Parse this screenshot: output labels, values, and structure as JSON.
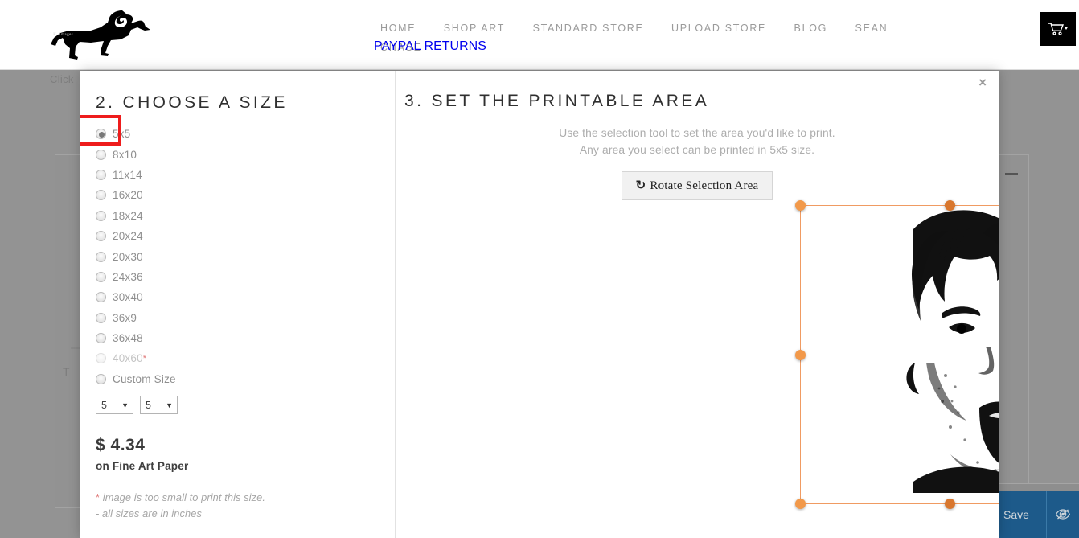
{
  "header": {
    "logo_caption": "J.K. Images",
    "nav": [
      {
        "label": "HOME"
      },
      {
        "label": "SHOP ART"
      },
      {
        "label": "STANDARD STORE"
      },
      {
        "label": "UPLOAD STORE"
      },
      {
        "label": "BLOG"
      },
      {
        "label": "SEAN"
      },
      {
        "label": "CHASE"
      }
    ],
    "nav_row2": [
      {
        "label": "PAYPAL RETURNS"
      }
    ],
    "cart_icon": "shopping-cart-icon"
  },
  "background": {
    "click_text": "Click",
    "t_text": "T",
    "save_label": "Save",
    "preview_icon": "eye-slash-icon"
  },
  "modal": {
    "close_label": "×",
    "size_step": {
      "title": "2. CHOOSE A SIZE",
      "options": [
        {
          "label": "5x5",
          "checked": true,
          "faded": false,
          "star": false
        },
        {
          "label": "8x10",
          "checked": false,
          "faded": false,
          "star": false
        },
        {
          "label": "11x14",
          "checked": false,
          "faded": false,
          "star": false
        },
        {
          "label": "16x20",
          "checked": false,
          "faded": false,
          "star": false
        },
        {
          "label": "18x24",
          "checked": false,
          "faded": false,
          "star": false
        },
        {
          "label": "20x24",
          "checked": false,
          "faded": false,
          "star": false
        },
        {
          "label": "20x30",
          "checked": false,
          "faded": false,
          "star": false
        },
        {
          "label": "24x36",
          "checked": false,
          "faded": false,
          "star": false
        },
        {
          "label": "30x40",
          "checked": false,
          "faded": false,
          "star": false
        },
        {
          "label": "36x9",
          "checked": false,
          "faded": false,
          "star": false
        },
        {
          "label": "36x48",
          "checked": false,
          "faded": false,
          "star": false
        },
        {
          "label": "40x60",
          "checked": false,
          "faded": true,
          "star": true
        },
        {
          "label": "Custom Size",
          "checked": false,
          "faded": false,
          "star": false
        }
      ],
      "custom_width": "5",
      "custom_height": "5",
      "price_currency": "$",
      "price_amount": "4.34",
      "paper_label": "on Fine Art Paper",
      "note_star": "*",
      "note_small": " image is too small to print this size.",
      "note_inches": "- all sizes are in inches"
    },
    "area_step": {
      "title": "3. SET THE PRINTABLE AREA",
      "help_line1": "Use the selection tool to set the area you'd like to print.",
      "help_line2": "Any area you select can be printed in 5x5 size.",
      "rotate_label": "Rotate Selection Area",
      "rotate_icon": "rotate-cw-icon"
    }
  },
  "colors": {
    "selection_orange": "#f2994a",
    "highlight_red": "#ee1c1c",
    "nav_grey": "#9b9b9b",
    "save_blue": "#1d5a8a"
  }
}
